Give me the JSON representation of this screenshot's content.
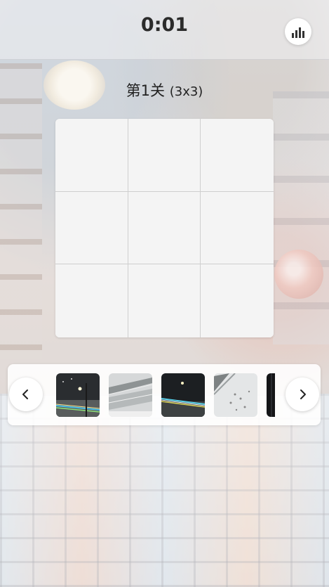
{
  "header": {
    "timer": "0:01",
    "stats_icon": "bar-chart-icon"
  },
  "level": {
    "title": "第1关",
    "grid_size": "(3x3)"
  },
  "board": {
    "rows": 3,
    "cols": 3
  },
  "picker": {
    "prev_icon": "chevron-left-icon",
    "next_icon": "chevron-right-icon",
    "thumbnails": [
      {
        "name": "night-street-light-trails"
      },
      {
        "name": "snowy-road-blur"
      },
      {
        "name": "night-traffic-light-streaks"
      },
      {
        "name": "snowy-road-footprints"
      },
      {
        "name": "dark-partial"
      }
    ]
  },
  "colors": {
    "board_bg": "#f4f4f4",
    "grid_line": "#cfcfcf",
    "timer_text": "#2b2b2b"
  }
}
